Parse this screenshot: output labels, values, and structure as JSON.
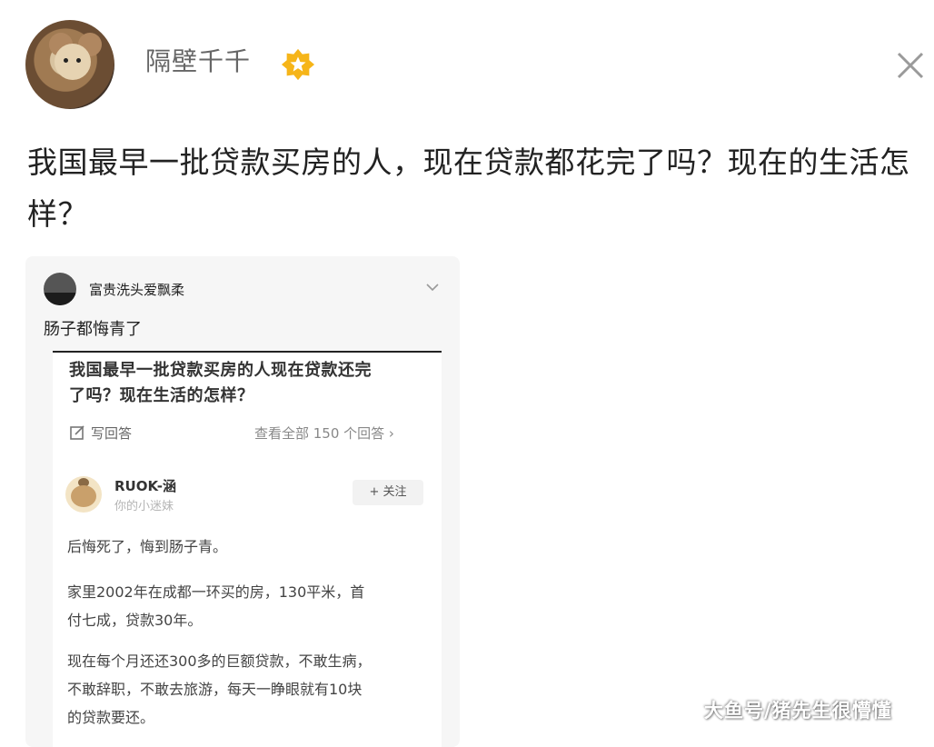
{
  "post": {
    "username": "隔壁千千",
    "title": "我国最早一批贷款买房的人，现在贷款都花完了吗？现在的生活怎样？"
  },
  "card": {
    "author": "富贵洗头爱飘柔",
    "comment": "肠子都悔青了",
    "question_title_line1": "我国最早一批贷款买房的人现在贷款还完",
    "question_title_line2": "了吗？现在生活的怎样？",
    "write_answer": "写回答",
    "view_all": "查看全部 150 个回答  ›",
    "answer": {
      "author": "RUOK-涵",
      "subtitle": "你的小迷妹",
      "follow": "+ 关注",
      "para1": "后悔死了，悔到肠子青。",
      "para2_line1": "家里2002年在成都一环买的房，130平米，首",
      "para2_line2": "付七成，贷款30年。",
      "para3_line1": "现在每个月还还300多的巨额贷款，不敢生病，",
      "para3_line2": "不敢辞职，不敢去旅游，每天一睁眼就有10块",
      "para3_line3": "的贷款要还。"
    }
  },
  "watermark": "大鱼号/猪先生很懵懂",
  "icons": {
    "verified_badge": "verified-star-badge-icon",
    "close": "close-icon",
    "chevron": "chevron-down-icon",
    "write": "edit-icon"
  },
  "colors": {
    "badge": "#f6b519",
    "username": "#666666",
    "card_bg": "#f6f6f6"
  }
}
